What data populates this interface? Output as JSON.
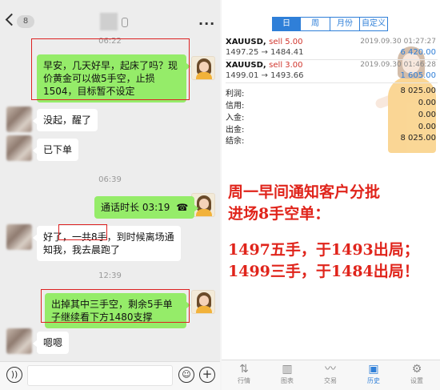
{
  "chat": {
    "back_badge": "8",
    "times": [
      "06:22",
      "06:39",
      "12:39"
    ],
    "messages": [
      {
        "text": "早安，几天好早，起床了吗？现价黄金可以做5手空，止损1504，目标暂不设定"
      },
      {
        "text": "没起，醒了"
      },
      {
        "text": "已下单"
      },
      {
        "text": "通话时长 03:19"
      },
      {
        "text_pre": "好了，",
        "text_boxed": "一共8手，",
        "text_post": "到时候离场通知我，我去晨跑了"
      },
      {
        "text": "出掉其中三手空，剩余5手单子继续看下方1480支撑"
      },
      {
        "text": "嗯嗯"
      }
    ],
    "icons": {
      "voice": "voice-icon",
      "emoji": "emoji-icon",
      "plus": "plus-icon",
      "phone": "phone-icon"
    }
  },
  "history": {
    "segments": [
      "日",
      "周",
      "月份",
      "自定义"
    ],
    "active_segment": "日",
    "trades": [
      {
        "symbol": "XAUUSD,",
        "side": "sell 5.00",
        "date": "2019.09.30 01:27:27",
        "prices": "1497.25 → 1484.41",
        "profit": "6 420.00"
      },
      {
        "symbol": "XAUUSD,",
        "side": "sell 3.00",
        "date": "2019.09.30 01:46:28",
        "prices": "1499.01 → 1493.66",
        "profit": "1 605.00"
      }
    ],
    "summary": [
      {
        "label": "利润:",
        "value": "8 025.00"
      },
      {
        "label": "信用:",
        "value": "0.00"
      },
      {
        "label": "入金:",
        "value": "0.00"
      },
      {
        "label": "出金:",
        "value": "0.00"
      },
      {
        "label": "结余:",
        "value": "8 025.00"
      }
    ]
  },
  "note": {
    "line1": "周一早间通知客户分批",
    "line2": "进场8手空单：",
    "line3": "1497五手，于1493出局；",
    "line4": "1499三手，于1484出局！"
  },
  "tabs": [
    {
      "label": "行情",
      "icon": "quotes-icon"
    },
    {
      "label": "图表",
      "icon": "chart-icon"
    },
    {
      "label": "交易",
      "icon": "trade-icon"
    },
    {
      "label": "历史",
      "icon": "history-icon"
    },
    {
      "label": "设置",
      "icon": "settings-icon"
    }
  ],
  "active_tab": "历史",
  "colors": {
    "accent": "#2f7fd8",
    "sell": "#d0342c",
    "note": "#e0241b",
    "bubble_out": "#95ec69"
  }
}
